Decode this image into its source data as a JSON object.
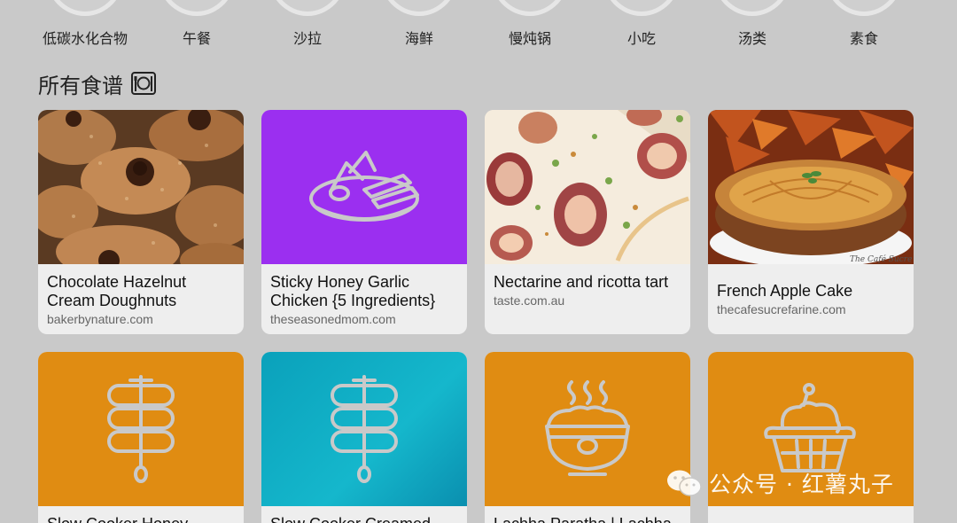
{
  "categories": [
    "低碳水化合物",
    "午餐",
    "沙拉",
    "海鲜",
    "慢炖锅",
    "小吃",
    "汤类",
    "素食"
  ],
  "section": {
    "title": "所有食谱",
    "icon": "plate-cutlery-icon"
  },
  "recipes": [
    {
      "title": "Chocolate Hazelnut Cream Doughnuts",
      "source": "bakerbynature.com",
      "thumb": "photo-doughnuts"
    },
    {
      "title": "Sticky Honey Garlic Chicken {5 Ingredients}",
      "source": "theseasonedmom.com",
      "thumb": "placeholder-platter-icon",
      "bg": "#9b2ff0"
    },
    {
      "title": "Nectarine and ricotta tart",
      "source": "taste.com.au",
      "thumb": "photo-tart"
    },
    {
      "title": "French Apple Cake",
      "source": "thecafesucrefarine.com",
      "thumb": "photo-apple-cake"
    },
    {
      "title": "Slow Cooker Honey",
      "source": "",
      "thumb": "placeholder-skewer-icon",
      "bg": "#e08c12"
    },
    {
      "title": "Slow Cooker Creamed",
      "source": "",
      "thumb": "placeholder-skewer-icon",
      "bg": "#0fa5c2"
    },
    {
      "title": "Lachha Paratha | Lachha",
      "source": "",
      "thumb": "placeholder-bowl-icon",
      "bg": "#e08c12"
    },
    {
      "title": "",
      "source": "",
      "thumb": "placeholder-cake-icon",
      "bg": "#e08c12"
    }
  ],
  "watermark": "公众号 · 红薯丸子",
  "photo_caption": "The Café Sucre F"
}
